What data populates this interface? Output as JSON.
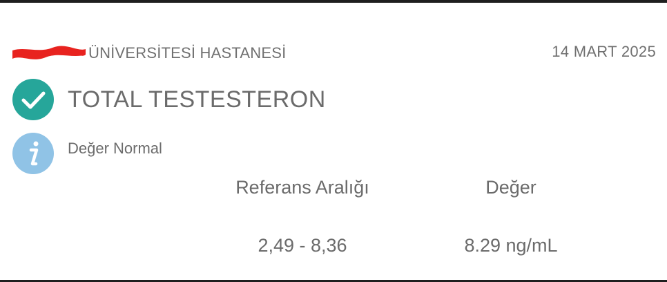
{
  "header": {
    "hospital_name": "ÜNİVERSİTESİ HASTANESİ",
    "date": "14 MART 2025"
  },
  "test": {
    "name": "TOTAL TESTESTERON",
    "status_icon": "check-circle-icon",
    "status_color": "#26a69a"
  },
  "info": {
    "text": "Değer Normal",
    "icon": "info-icon",
    "icon_color": "#90c3e6"
  },
  "results": {
    "reference_label": "Referans Aralığı",
    "value_label": "Değer",
    "reference_range": "2,49 - 8,36",
    "value": "8.29 ng/mL"
  }
}
